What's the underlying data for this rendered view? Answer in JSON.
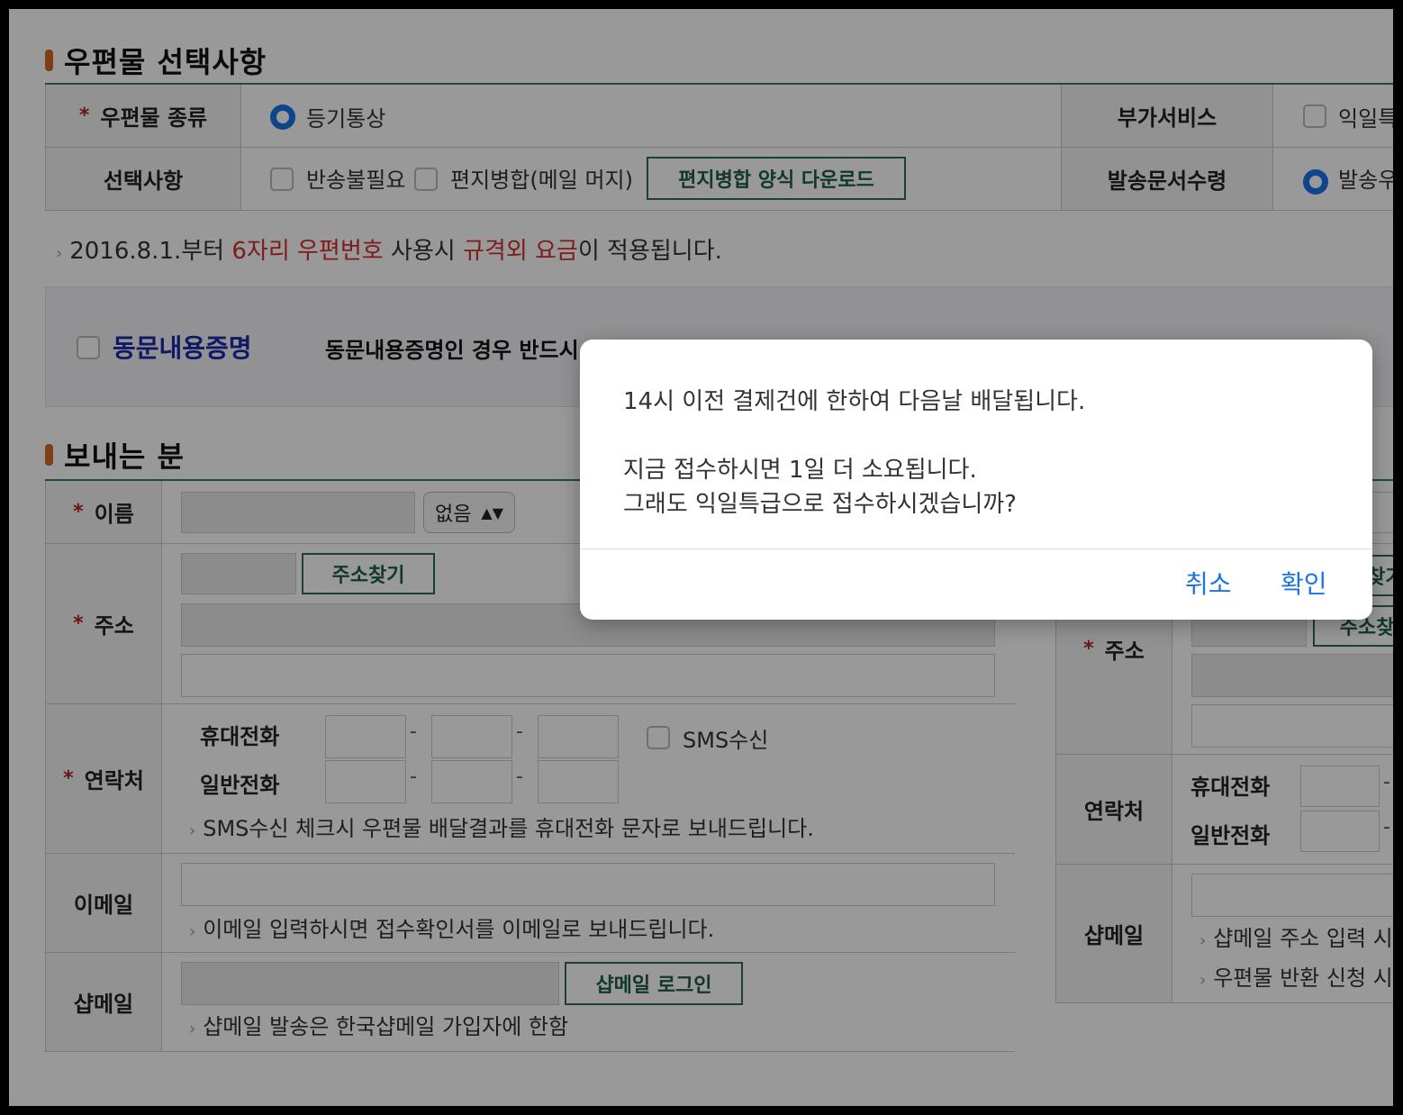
{
  "section1": {
    "title": "우편물 선택사항",
    "row1": {
      "label": "우편물 종류",
      "radio_label": "등기통상",
      "extra_label": "부가서비스",
      "extra_option": "익일특"
    },
    "row2": {
      "label": "선택사항",
      "opt1": "반송불필요",
      "opt2": "편지병합(메일 머지)",
      "download_button": "편지병합 양식 다운로드",
      "extra_label": "발송문서수령",
      "extra_option": "발송우"
    },
    "notice": {
      "prefix": "2016.8.1.부터 ",
      "red1": "6자리 우편번호",
      "mid": " 사용시 ",
      "red2": "규격외 요금",
      "suffix": "이 적용됩니다."
    }
  },
  "dongmun": {
    "label": "동문내용증명",
    "desc": "동문내용증명인 경우 반드시"
  },
  "section2": {
    "title": "보내는 분",
    "name": {
      "label": "이름",
      "select_value": "없음"
    },
    "address": {
      "label": "주소",
      "search_button": "주소찾기"
    },
    "contact": {
      "label": "연락처",
      "mobile": "휴대전화",
      "phone": "일반전화",
      "sms_label": "SMS수신",
      "note": "SMS수신 체크시 우편물 배달결과를 휴대전화 문자로 보내드립니다."
    },
    "email": {
      "label": "이메일",
      "note": "이메일 입력하시면 접수확인서를 이메일로 보내드립니다."
    },
    "shopmail": {
      "label": "샵메일",
      "login_button": "샵메일 로그인",
      "note": "샵메일 발송은 한국샵메일 가입자에 한함"
    }
  },
  "receiver": {
    "address_label": "주소",
    "search_button_partial": "주소찾기",
    "search_button_partial2": "주소찾",
    "contact_label": "연락처",
    "mobile": "휴대전화",
    "phone": "일반전화",
    "shopmail_label": "샵메일",
    "note1": "샵메일 주소 입력 시",
    "note2": "우편물 반환 신청 시"
  },
  "dialog": {
    "line1": "14시 이전 결제건에 한하여 다음날 배달됩니다.",
    "line2": "지금 접수하시면 1일 더 소요됩니다.",
    "line3": "그래도 익일특급으로 접수하시겠습니까?",
    "cancel": "취소",
    "confirm": "확인"
  },
  "colors": {
    "accent_green": "#2e6d5c",
    "required_red": "#b22222",
    "dialog_blue": "#1a73e8",
    "section_bullet": "#d2691e"
  }
}
